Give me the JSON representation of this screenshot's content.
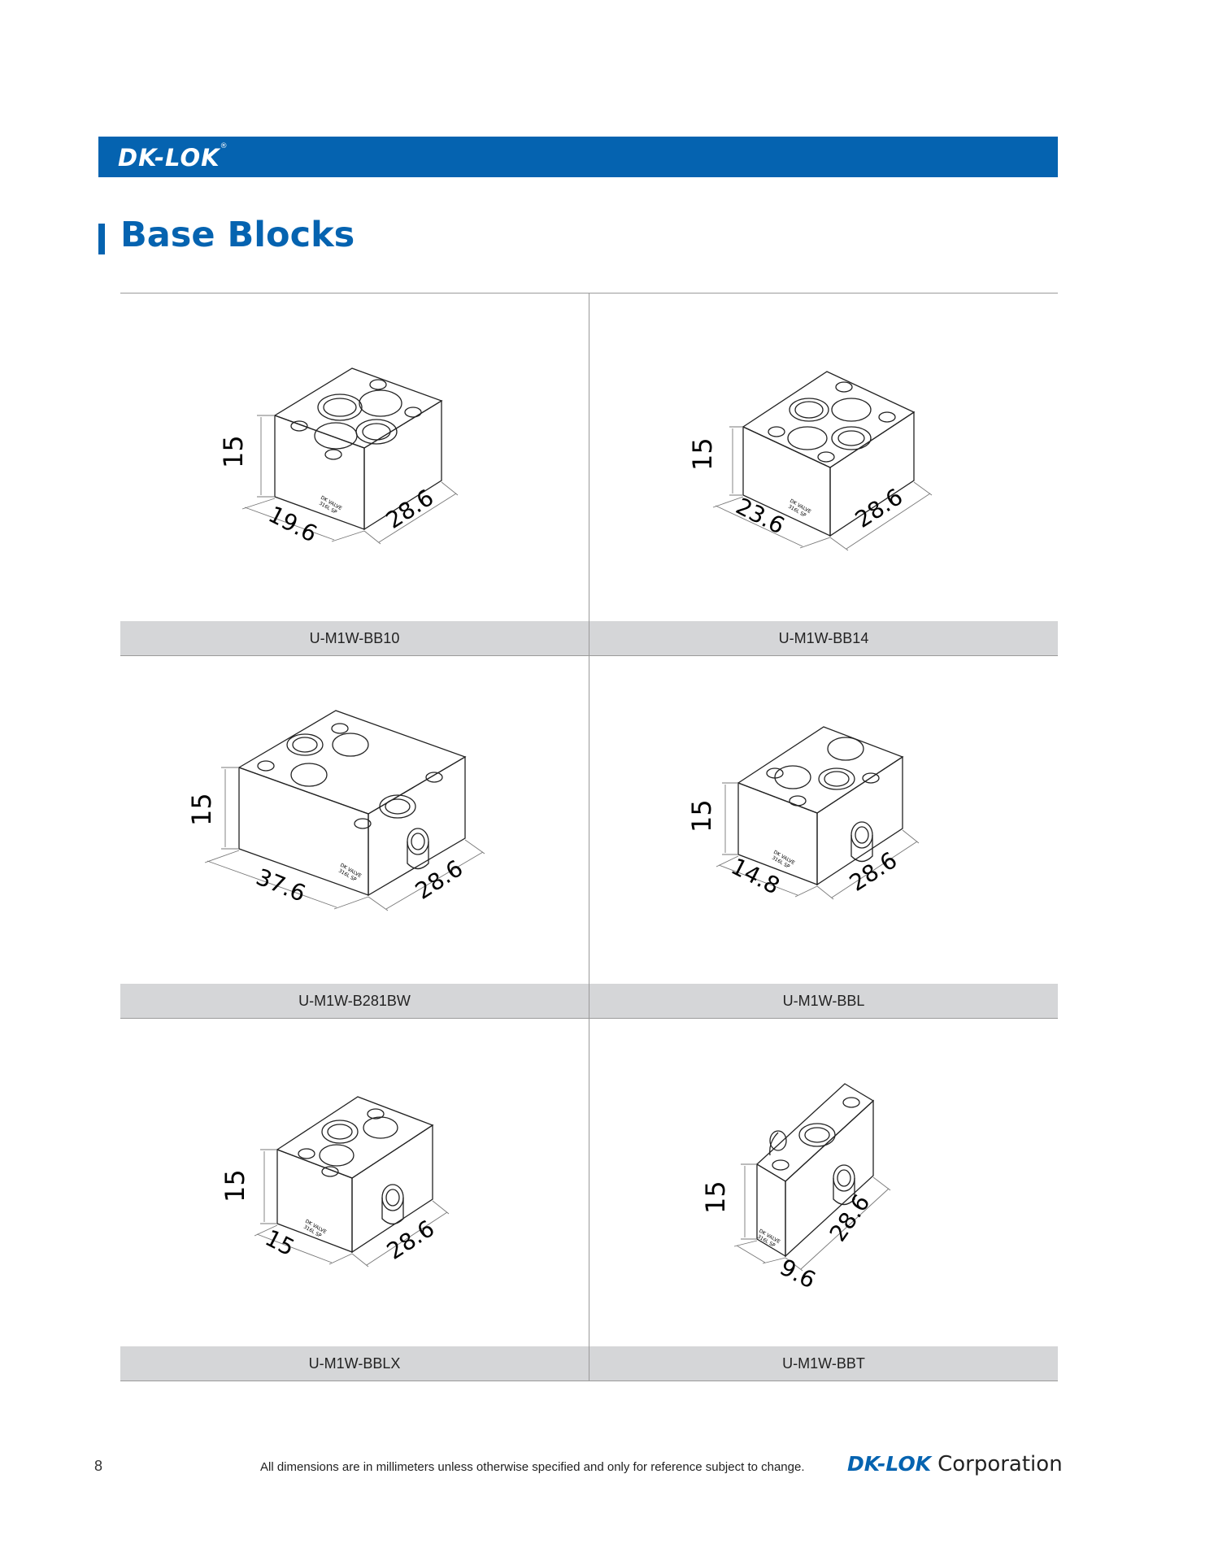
{
  "header": {
    "logo": "DK-LOK",
    "registered": "®"
  },
  "page": {
    "title": "Base Blocks"
  },
  "products": [
    {
      "part": "U-M1W-BB10",
      "height": "15",
      "width": "19.6",
      "length": "28.6",
      "marking_1": "DK VALVE",
      "marking_2": "316L SP"
    },
    {
      "part": "U-M1W-BB14",
      "height": "15",
      "width": "23.6",
      "length": "28.6",
      "marking_1": "DK VALVE",
      "marking_2": "316L SP"
    },
    {
      "part": "U-M1W-B281BW",
      "height": "15",
      "width": "37.6",
      "length": "28.6",
      "marking_1": "DK VALVE",
      "marking_2": "316L SP"
    },
    {
      "part": "U-M1W-BBL",
      "height": "15",
      "width": "14.8",
      "length": "28.6",
      "marking_1": "DK VALVE",
      "marking_2": "316L SP"
    },
    {
      "part": "U-M1W-BBLX",
      "height": "15",
      "width": "15",
      "length": "28.6",
      "marking_1": "DK VALVE",
      "marking_2": "316L SP"
    },
    {
      "part": "U-M1W-BBT",
      "height": "15",
      "width": "9.6",
      "length": "28.6",
      "marking_1": "DK VALVE",
      "marking_2": "316L SP"
    }
  ],
  "footer": {
    "page_number": "8",
    "note": "All dimensions are in millimeters unless otherwise specified and only for reference subject to change.",
    "brand": "DK-LOK",
    "corporation": "Corporation"
  }
}
